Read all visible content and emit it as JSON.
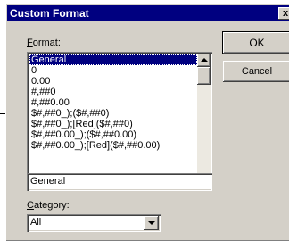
{
  "dialog": {
    "title": "Custom Format",
    "close_glyph": "x"
  },
  "format": {
    "label_accel": "F",
    "label_rest": "ormat:",
    "items": [
      "General",
      "0",
      "0.00",
      "#,##0",
      "#,##0.00",
      "$#,##0_);($#,##0)",
      "$#,##0_);[Red]($#,##0)",
      "$#,##0.00_);($#,##0.00)",
      "$#,##0.00_);[Red]($#,##0.00)"
    ],
    "selected_index": 0,
    "input_value": "General"
  },
  "category": {
    "label_accel": "C",
    "label_rest": "ategory:",
    "value": "All"
  },
  "buttons": {
    "ok": "OK",
    "cancel": "Cancel"
  },
  "colors": {
    "face": "#d4d0c8",
    "titlebar": "#000080",
    "selection": "#000080"
  }
}
